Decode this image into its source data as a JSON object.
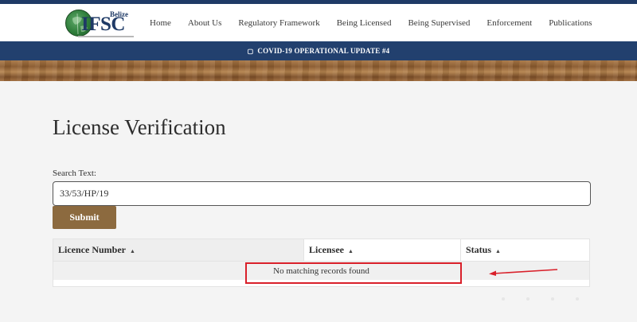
{
  "header": {
    "logo": {
      "line1": "Belize",
      "line2": "IFSC"
    },
    "nav": [
      "Home",
      "About Us",
      "Regulatory Framework",
      "Being Licensed",
      "Being Supervised",
      "Enforcement",
      "Publications"
    ]
  },
  "banner": {
    "icon": "megaphone-icon",
    "text": "COVID-19 OPERATIONAL UPDATE #4"
  },
  "main": {
    "title": "License Verification",
    "search": {
      "label": "Search Text:",
      "value": "33/53/HP/19"
    },
    "submit_label": "Submit",
    "table": {
      "columns": [
        "Licence Number",
        "Licensee",
        "Status"
      ],
      "empty_message": "No matching records found"
    }
  },
  "annotation": {
    "color": "#d9202a"
  },
  "colors": {
    "navy": "#1f3a66",
    "button": "#8c6a3f"
  }
}
